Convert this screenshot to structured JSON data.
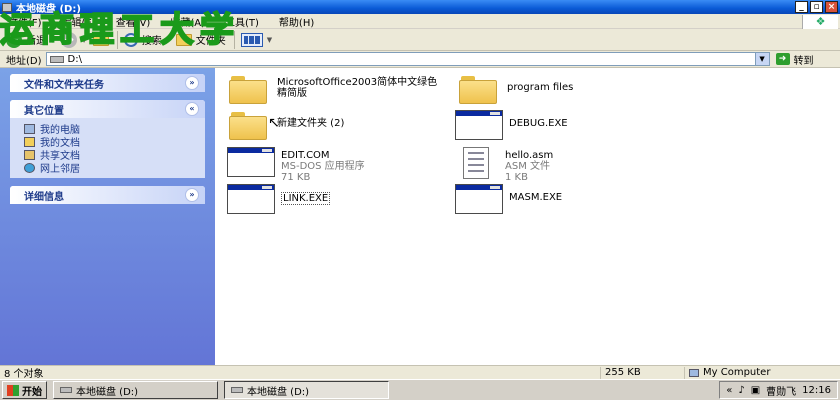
{
  "window": {
    "title": "本地磁盘 (D:)"
  },
  "watermark": {
    "text": "运商理工大学"
  },
  "menu": [
    "文件(F)",
    "编辑(E)",
    "查看(V)",
    "收藏(A)",
    "工具(T)",
    "帮助(H)"
  ],
  "toolbar": {
    "back_label": "后退",
    "search_label": "搜索",
    "folders_label": "文件夹"
  },
  "address": {
    "label": "地址(D)",
    "value": "D:\\",
    "go_label": "转到"
  },
  "left_pane": {
    "file_tasks_title": "文件和文件夹任务",
    "other_places_title": "其它位置",
    "places": [
      {
        "label": "我的电脑",
        "icon": "my-computer-icon"
      },
      {
        "label": "我的文档",
        "icon": "my-documents-icon"
      },
      {
        "label": "共享文档",
        "icon": "shared-documents-icon"
      },
      {
        "label": "网上邻居",
        "icon": "network-places-icon"
      }
    ],
    "details_title": "详细信息"
  },
  "items": [
    {
      "name": "MicrosoftOffice2003简体中文绿色精简版",
      "type": "folder"
    },
    {
      "name": "program files",
      "type": "folder"
    },
    {
      "name": "新建文件夹 (2)",
      "type": "folder"
    },
    {
      "name": "DEBUG.EXE",
      "type": "exe"
    },
    {
      "name": "EDIT.COM",
      "sub1": "MS-DOS 应用程序",
      "sub2": "71 KB",
      "type": "exe"
    },
    {
      "name": "hello.asm",
      "sub1": "ASM 文件",
      "sub2": "1 KB",
      "type": "doc"
    },
    {
      "name": "LINK.EXE",
      "type": "exe"
    },
    {
      "name": "MASM.EXE",
      "type": "exe"
    }
  ],
  "status": {
    "count": "8 个对象",
    "size": "255 KB",
    "location": "My Computer"
  },
  "taskbar": {
    "start_label": "开始",
    "task1": "本地磁盘 (D:)",
    "task2": "本地磁盘 (D:)",
    "tray_text": "曹勋飞",
    "clock": "12:16"
  },
  "colors": {
    "titlebar": "#0a5ad6",
    "left_pane": "#6f8fe0",
    "watermark_fill": "#f4e400",
    "watermark_stroke": "#1a9a1a"
  }
}
